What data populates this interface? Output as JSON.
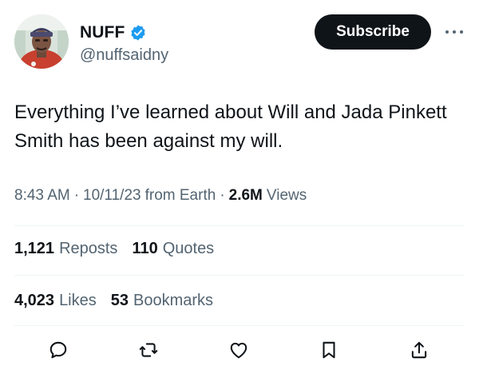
{
  "author": {
    "display_name": "NUFF",
    "handle": "@nuffsaidny",
    "verified": true,
    "avatar_icon": "user-avatar-photo"
  },
  "header": {
    "subscribe_label": "Subscribe",
    "more_icon": "more-horizontal-icon"
  },
  "tweet": {
    "text": "Everything I’ve learned about Will and Jada Pinkett Smith has been against my will."
  },
  "meta": {
    "time": "8:43 AM",
    "date": "10/11/23",
    "source": "from Earth",
    "views_count": "2.6M",
    "views_label": "Views"
  },
  "stats_row1": {
    "reposts_count": "1,121",
    "reposts_label": "Reposts",
    "quotes_count": "110",
    "quotes_label": "Quotes"
  },
  "stats_row2": {
    "likes_count": "4,023",
    "likes_label": "Likes",
    "bookmarks_count": "53",
    "bookmarks_label": "Bookmarks"
  },
  "actions": [
    "reply-icon",
    "repost-icon",
    "like-icon",
    "bookmark-icon",
    "share-icon"
  ],
  "colors": {
    "text_primary": "#0f1419",
    "text_secondary": "#536471",
    "verified_blue": "#1d9bf0",
    "divider": "#eff3f4",
    "button_dark": "#0f1419"
  }
}
